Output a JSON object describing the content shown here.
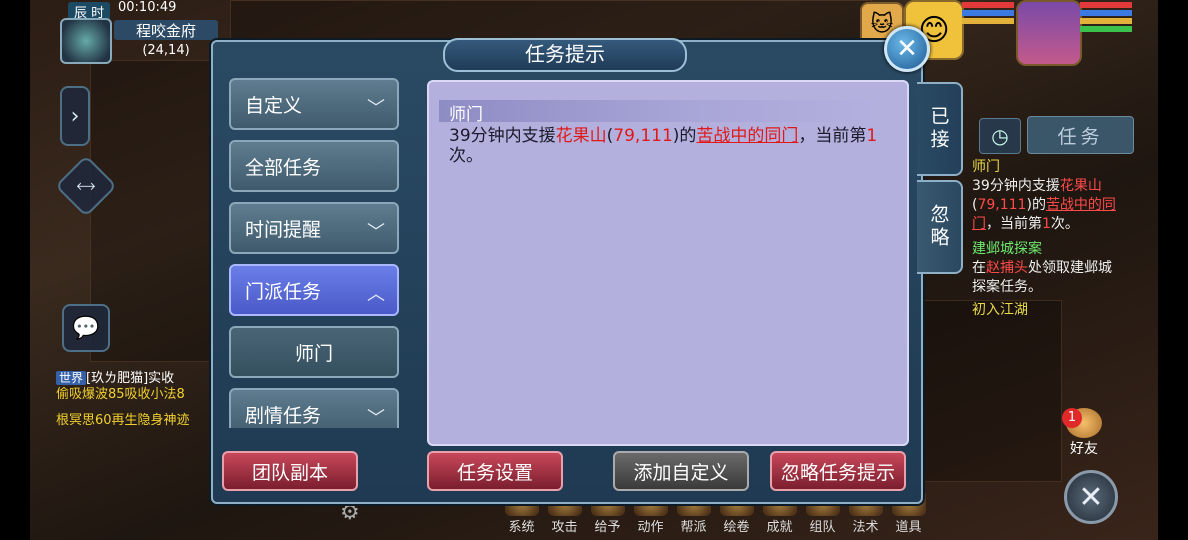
{
  "hud": {
    "time_period": "辰 时",
    "clock": "00:10:49",
    "map_name": "程咬金府",
    "coords": "(24,14)",
    "friend_badge": "1",
    "friend_label": "好友"
  },
  "chat": {
    "channel": "世界",
    "line1": "[玖ㄌ肥猫]实收",
    "line2": "偷吸爆波85吸收小法8",
    "line3": "根冥思60再生隐身神迹"
  },
  "tracker": {
    "tab": "任务",
    "q1_title": "师门",
    "q1_a": "39分钟内支援",
    "q1_place": "花果山",
    "q1_coords": "79,111",
    "q1_b": "的",
    "q1_target": "苦战中的同门",
    "q1_c": "，当前第",
    "q1_count": "1",
    "q1_d": "次。",
    "q2_title": "建邺城探案",
    "q2_a": "在",
    "q2_npc": "赵捕头",
    "q2_b": "处领取建邺城探案任务。",
    "q3_title": "初入江湖"
  },
  "bottom": [
    "系统",
    "攻击",
    "给予",
    "动作",
    "帮派",
    "绘卷",
    "成就",
    "组队",
    "法术",
    "道具"
  ],
  "dialog": {
    "title": "任务提示",
    "categories": [
      "自定义",
      "全部任务",
      "时间提醒",
      "门派任务",
      "师门",
      "剧情任务"
    ],
    "detail": {
      "name": "师门",
      "part_a": "39分钟内支援",
      "place": "花果山",
      "coords": "79,111",
      "part_b": "的",
      "target": "苦战中的同门",
      "part_c": "，当前第",
      "count": "1",
      "part_d": "次。"
    },
    "tabs": [
      "已接",
      "忽略"
    ],
    "buttons": [
      "团队副本",
      "任务设置",
      "添加自定义",
      "忽略任务提示"
    ]
  }
}
